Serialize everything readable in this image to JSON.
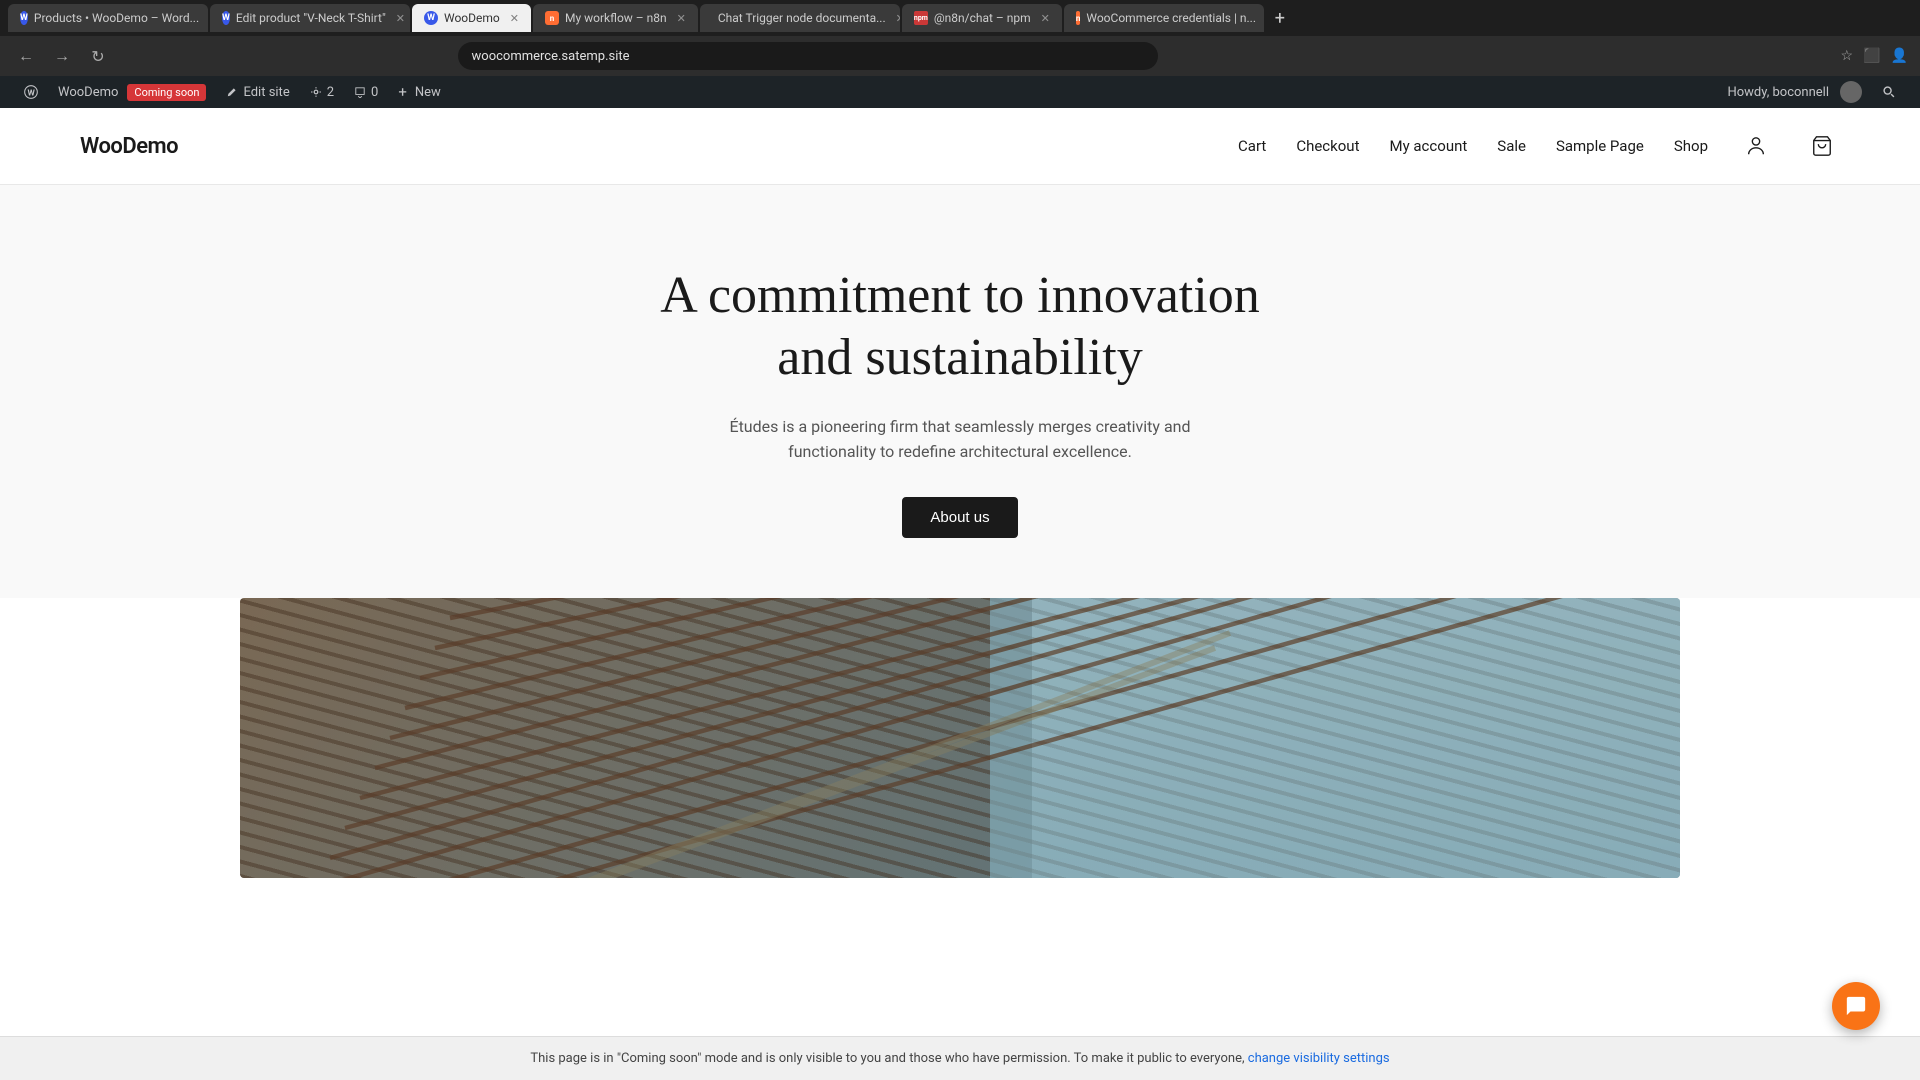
{
  "browser": {
    "tabs": [
      {
        "id": "tab1",
        "label": "Products • WooDemo – Word...",
        "favicon": "wp",
        "active": false
      },
      {
        "id": "tab2",
        "label": "Edit product \"V-Neck T-Shirt\"",
        "favicon": "wp",
        "active": false
      },
      {
        "id": "tab3",
        "label": "WooDemo",
        "favicon": "wp",
        "active": true
      },
      {
        "id": "tab4",
        "label": "My workflow – n8n",
        "favicon": "n8n",
        "active": false
      },
      {
        "id": "tab5",
        "label": "Chat Trigger node documenta...",
        "favicon": "chat",
        "active": false
      },
      {
        "id": "tab6",
        "label": "@n8n/chat – npm",
        "favicon": "npm",
        "active": false
      },
      {
        "id": "tab7",
        "label": "WooCommerce credentials | n...",
        "favicon": "n8n",
        "active": false
      }
    ],
    "url": "woocommerce.satemp.site"
  },
  "wp_admin_bar": {
    "logo_label": "WP",
    "site_name": "WooDemo",
    "coming_soon_label": "Coming soon",
    "edit_site_label": "Edit site",
    "customizer_count": "2",
    "comments_count": "0",
    "new_label": "New",
    "howdy": "Howdy, boconnell",
    "search_icon": "search"
  },
  "site_header": {
    "logo": "WooDemo",
    "nav_items": [
      {
        "label": "Cart",
        "href": "#"
      },
      {
        "label": "Checkout",
        "href": "#"
      },
      {
        "label": "My account",
        "href": "#"
      },
      {
        "label": "Sale",
        "href": "#"
      },
      {
        "label": "Sample Page",
        "href": "#"
      },
      {
        "label": "Shop",
        "href": "#"
      }
    ],
    "account_icon": "person",
    "cart_icon": "cart"
  },
  "hero": {
    "title_line1": "A commitment to innovation",
    "title_line2": "and sustainability",
    "description": "Études is a pioneering firm that seamlessly merges creativity and functionality to redefine architectural excellence.",
    "cta_button": "About us"
  },
  "coming_soon_banner": {
    "message": "This page is in \"Coming soon\" mode and is only visible to you and those who have permission. To make it public to everyone,",
    "link_text": "change visibility settings"
  }
}
